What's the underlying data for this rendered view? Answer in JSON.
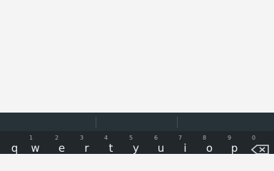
{
  "keyboard": {
    "suggestions": [
      "",
      "",
      ""
    ],
    "keys": [
      {
        "letter": "q",
        "hint": ""
      },
      {
        "letter": "w",
        "hint": "1"
      },
      {
        "letter": "e",
        "hint": "2"
      },
      {
        "letter": "r",
        "hint": "3"
      },
      {
        "letter": "t",
        "hint": "4"
      },
      {
        "letter": "y",
        "hint": "5"
      },
      {
        "letter": "u",
        "hint": "6"
      },
      {
        "letter": "i",
        "hint": "7"
      },
      {
        "letter": "o",
        "hint": "8"
      },
      {
        "letter": "p",
        "hint": "9"
      },
      {
        "letter": "",
        "hint": "0"
      }
    ],
    "backspace_icon": "backspace-icon",
    "colors": {
      "keyboard_bg": "#21272b",
      "strip_bg": "#263238",
      "key_text": "#eef2f4",
      "hint_text": "#a9b3b8"
    }
  }
}
